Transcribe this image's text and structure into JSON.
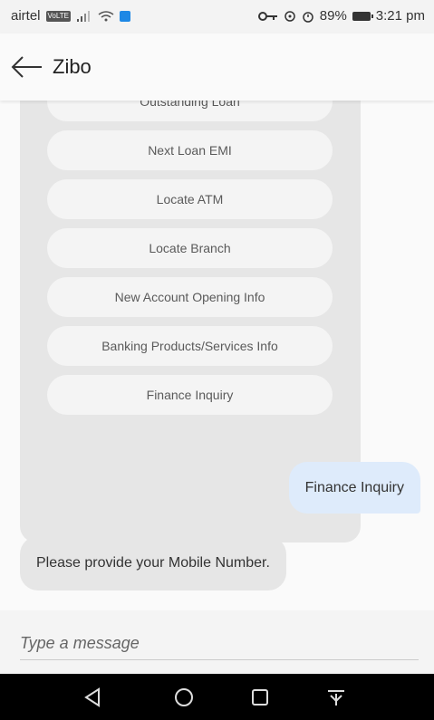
{
  "status_bar": {
    "carrier": "airtel",
    "network_tag": "VoLTE",
    "battery": "89%",
    "time": "3:21 pm"
  },
  "app_bar": {
    "title": "Zibo"
  },
  "options": [
    {
      "label": "Outstanding Loan"
    },
    {
      "label": "Next Loan EMI"
    },
    {
      "label": "Locate ATM"
    },
    {
      "label": "Locate Branch"
    },
    {
      "label": "New Account Opening Info"
    },
    {
      "label": "Banking Products/Services Info"
    },
    {
      "label": "Finance Inquiry"
    }
  ],
  "messages": {
    "user": "Finance Inquiry",
    "bot": "Please provide your Mobile Number."
  },
  "composer": {
    "placeholder": "Type a message"
  },
  "colors": {
    "user_bubble": "#deebfb",
    "bot_bubble": "#e6e6e6",
    "option_card": "#e6e6e6",
    "option_button": "#f4f4f4"
  }
}
